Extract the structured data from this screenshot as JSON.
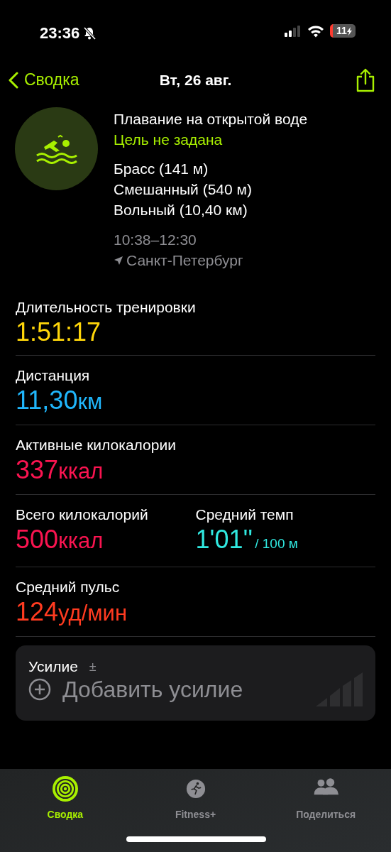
{
  "status_bar": {
    "time": "23:36",
    "silent": true,
    "battery": "11"
  },
  "nav": {
    "back": "Сводка",
    "title": "Вт, 26 авг."
  },
  "workout": {
    "name": "Плавание на открытой воде",
    "goal": "Цель не задана",
    "strokes": [
      "Брасс (141 м)",
      "Смешанный (540 м)",
      "Вольный (10,40 км)"
    ],
    "time_range": "10:38–12:30",
    "location": "Санкт-Петербург"
  },
  "metric_rows": [
    [
      {
        "label": "Длительность тренировки",
        "value": "1:51:17",
        "color": "#ffd60a"
      }
    ],
    [
      {
        "label": "Дистанция",
        "value": "11,30",
        "unit": "км",
        "color": "#20b6fb"
      }
    ],
    [
      {
        "label": "Активные килокалории",
        "value": "337",
        "unit": "ккал",
        "color": "#fa1450"
      }
    ],
    [
      {
        "label": "Всего килокалорий",
        "value": "500",
        "unit": "ккал",
        "color": "#fa1450"
      },
      {
        "label": "Средний темп",
        "value": "1'01''",
        "unit": "/ 100 м",
        "small_unit": true,
        "color": "#30e8e0"
      }
    ],
    [
      {
        "label": "Средний пульс",
        "value": "124",
        "unit": "уд/мин",
        "color": "#ff3b20"
      }
    ]
  ],
  "effort": {
    "label": "Усилие",
    "symbol": "±",
    "action": "Добавить усилие"
  },
  "tabs": [
    {
      "label": "Сводка",
      "kind": "rings",
      "selected": true
    },
    {
      "label": "Fitness+",
      "kind": "runner",
      "selected": false
    },
    {
      "label": "Поделиться",
      "kind": "people",
      "selected": false
    }
  ]
}
